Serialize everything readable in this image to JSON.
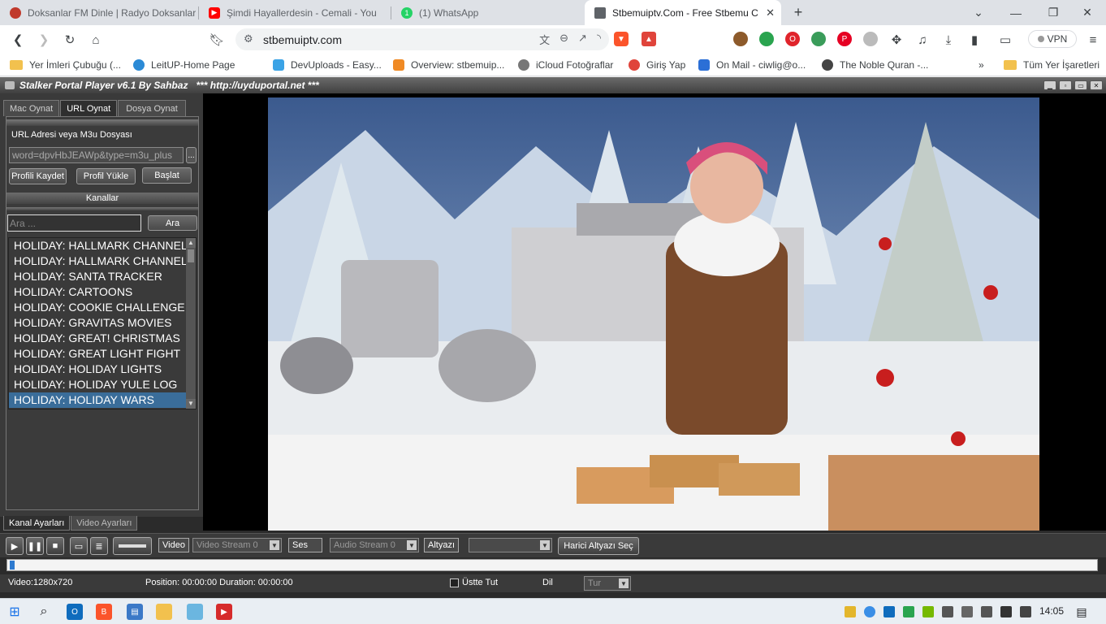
{
  "browser": {
    "tabs": [
      {
        "title": "Doksanlar FM Dinle | Radyo Doksanlar",
        "color": "#c0392b"
      },
      {
        "title": "Şimdi Hayallerdesin - Cemali - You",
        "color": "#ff0000"
      },
      {
        "title": "(1) WhatsApp",
        "color": "#25d366"
      },
      {
        "title": "Stbemuiptv.Com - Free Stbemu C",
        "color": "#5f6368"
      }
    ],
    "new_tab": "+",
    "url": "stbemuiptv.com",
    "vpn_label": "VPN",
    "bookmarks": [
      "Yer İmleri Çubuğu (...",
      "LeitUP-Home Page",
      "DevUploads - Easy...",
      "Overview: stbemuip...",
      "iCloud Fotoğraflar",
      "Giriş Yap",
      "On Mail - ciwlig@o...",
      "The Noble Quran -..."
    ],
    "bookmarks_more": "»",
    "all_bookmarks": "Tüm Yer İşaretleri"
  },
  "app": {
    "title": "Stalker Portal Player v6.1 By Sahbaz",
    "title_url": "*** http://uyduportal.net ***",
    "left_tabs": [
      "Mac Oynat",
      "URL Oynat",
      "Dosya Oynat"
    ],
    "url_label": "URL Adresi veya M3u Dosyası",
    "url_value": "word=dpvHbJEAWp&type=m3u_plus",
    "browse": "...",
    "buttons": {
      "save_profile": "Profili Kaydet",
      "load_profile": "Profil Yükle",
      "start": "Başlat"
    },
    "channels_header": "Kanallar",
    "search_placeholder": "Ara ...",
    "search_button": "Ara",
    "channels": [
      "HOLIDAY: HALLMARK CHANNEL",
      "HOLIDAY: HALLMARK CHANNEL (",
      "HOLIDAY: SANTA TRACKER",
      "HOLIDAY: CARTOONS",
      "HOLIDAY: COOKIE CHALLENGE",
      "HOLIDAY: GRAVITAS MOVIES",
      "HOLIDAY: GREAT! CHRISTMAS",
      "HOLIDAY: GREAT LIGHT FIGHT",
      "HOLIDAY: HOLIDAY LIGHTS",
      "HOLIDAY: HOLIDAY YULE LOG",
      "HOLIDAY: HOLIDAY WARS"
    ],
    "bottom_tabs": [
      "Kanal Ayarları",
      "Video Ayarları"
    ],
    "controls": {
      "video_label": "Video",
      "video_stream": "Video Stream 0",
      "audio_label": "Ses",
      "audio_stream": "Audio Stream 0",
      "subtitle_label": "Altyazı",
      "subtitle_value": "",
      "external_subtitle": "Harici Altyazı Seç"
    },
    "status": {
      "resolution": "Video:1280x720",
      "position": "Position: 00:00:00 Duration: 00:00:00",
      "stay_on_top": "Üstte Tut",
      "lang_label": "Dil",
      "lang_value": "Tur"
    }
  },
  "taskbar": {
    "time": "14:05"
  }
}
